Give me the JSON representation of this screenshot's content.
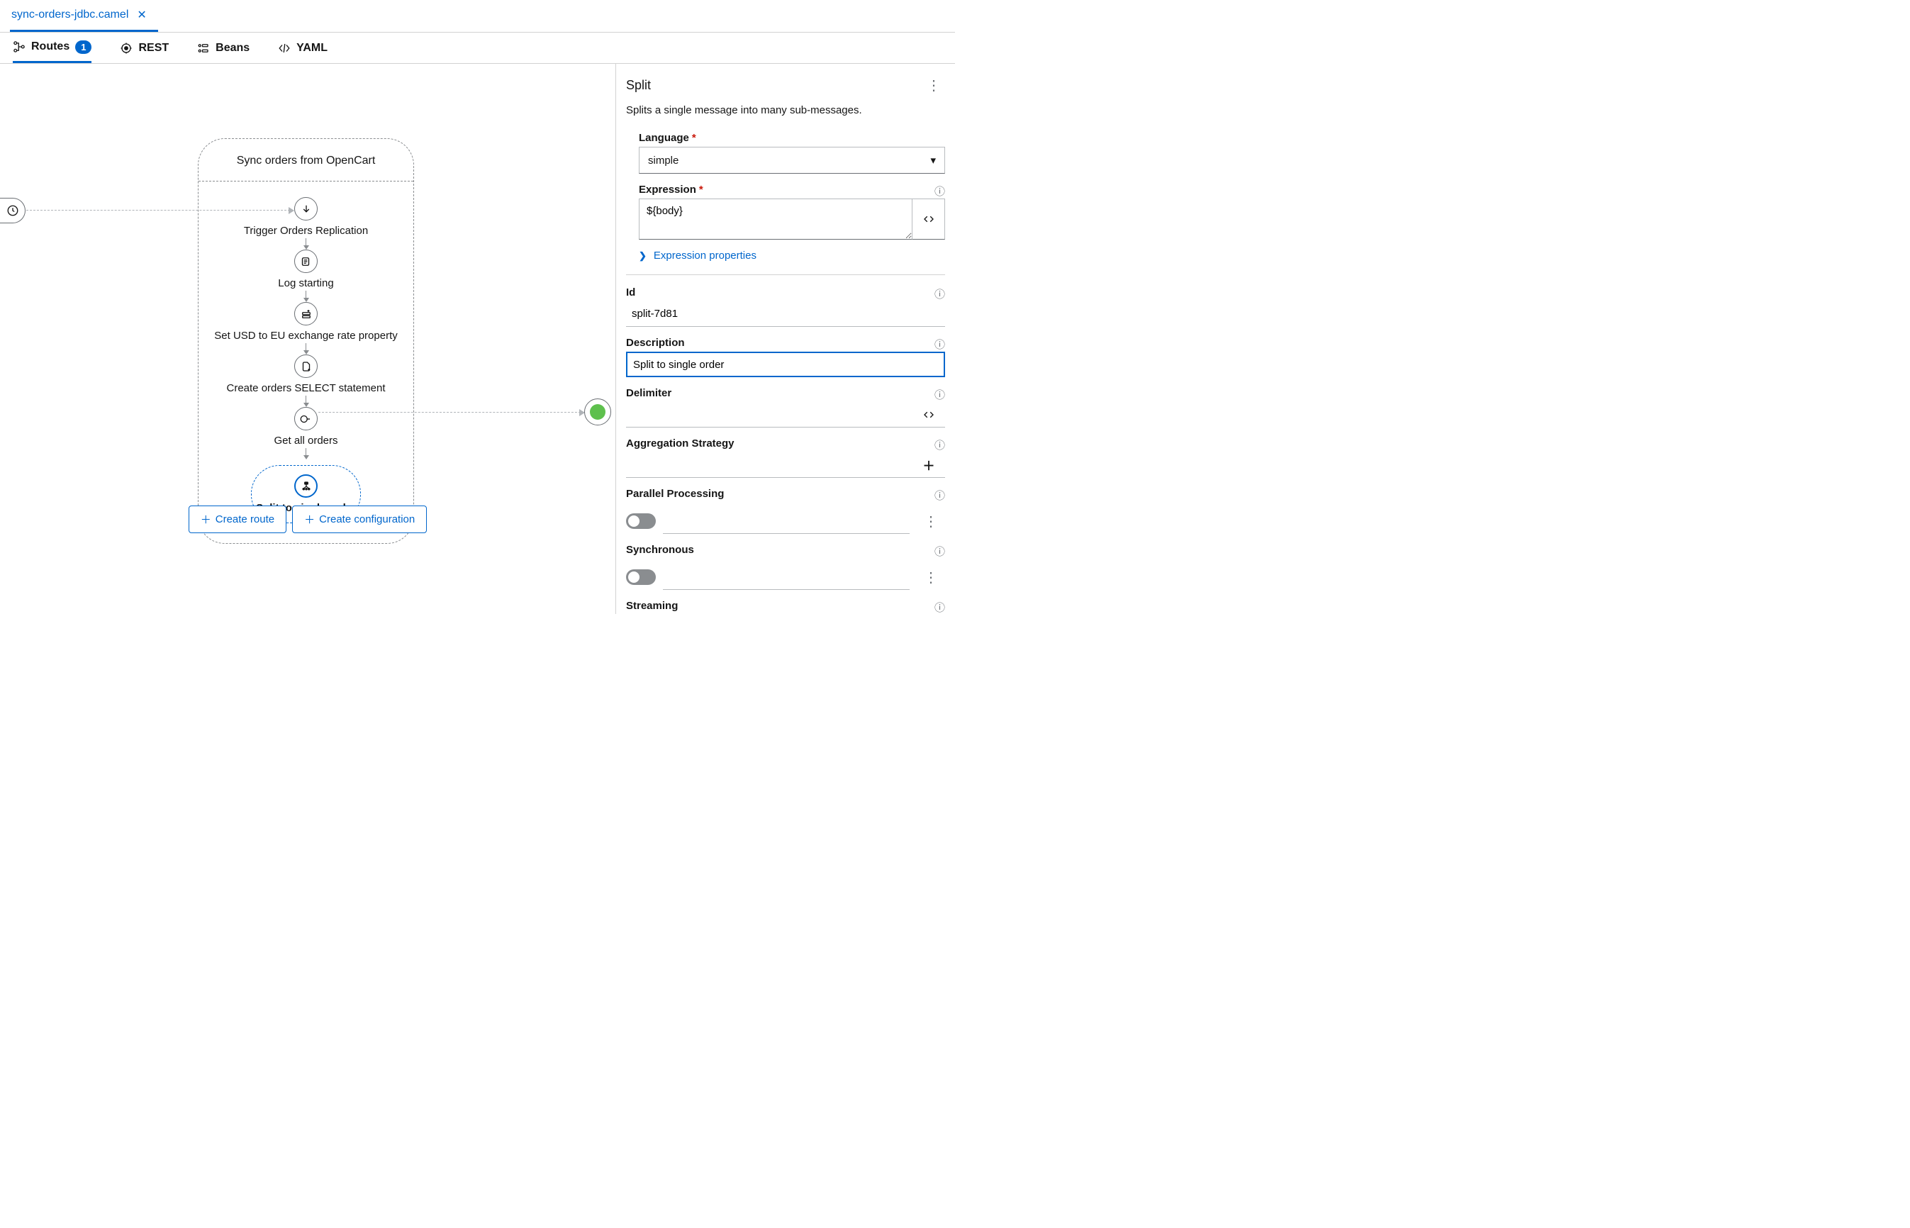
{
  "file_tab": {
    "name": "sync-orders-jdbc.camel"
  },
  "view_tabs": {
    "routes": "Routes",
    "routes_badge": "1",
    "rest": "REST",
    "beans": "Beans",
    "yaml": "YAML"
  },
  "route": {
    "title": "Sync orders from OpenCart",
    "steps": [
      "Trigger Orders Replication",
      "Log starting",
      "Set USD to EU exchange rate property",
      "Create orders SELECT statement",
      "Get all orders"
    ],
    "split_label": "Split to single order"
  },
  "canvas_buttons": {
    "create_route": "Create route",
    "create_config": "Create configuration"
  },
  "panel": {
    "title": "Split",
    "description": "Splits a single message into many sub-messages.",
    "language_label": "Language",
    "language_value": "simple",
    "expression_label": "Expression",
    "expression_value": "${body}",
    "expression_properties": "Expression properties",
    "id_label": "Id",
    "id_value": "split-7d81",
    "description_label": "Description",
    "description_value": "Split to single order",
    "delimiter_label": "Delimiter",
    "delimiter_value": "",
    "agg_label": "Aggregation Strategy",
    "agg_value": "",
    "parallel_label": "Parallel Processing",
    "sync_label": "Synchronous",
    "stream_label": "Streaming"
  }
}
